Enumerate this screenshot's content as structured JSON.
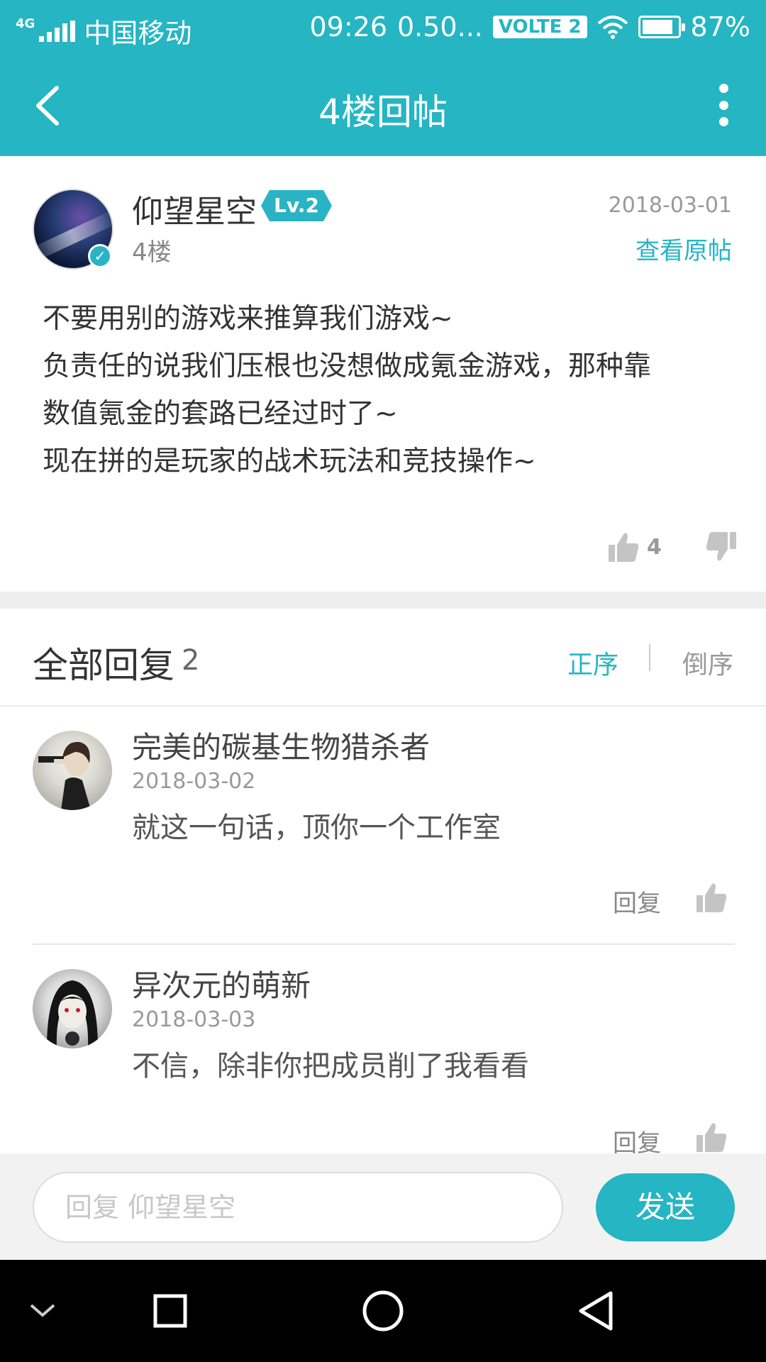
{
  "status_bar": {
    "network_type": "4G",
    "carrier": "中国移动",
    "time": "09:26",
    "speed": "0.50...",
    "volte": "VOLTE 2",
    "battery_percent": "87%",
    "battery_level": 0.87
  },
  "app_bar": {
    "title": "4楼回帖",
    "back_icon": "chevron-left-icon",
    "more_icon": "more-vertical-icon"
  },
  "post": {
    "author": "仰望星空",
    "level": "Lv.2",
    "floor": "4楼",
    "date": "2018-03-01",
    "view_original": "查看原帖",
    "content_lines": [
      "不要用别的游戏来推算我们游戏~",
      "负责任的说我们压根也没想做成氪金游戏，那种靠",
      "数值氪金的套路已经过时了~",
      "现在拼的是玩家的战术玩法和竞技操作~"
    ],
    "like_count": "4"
  },
  "replies": {
    "title": "全部回复",
    "count": "2",
    "sort_asc": "正序",
    "sort_desc": "倒序",
    "items": [
      {
        "name": "完美的碳基生物猎杀者",
        "date": "2018-03-02",
        "text": "就这一句话，顶你一个工作室",
        "reply_label": "回复"
      },
      {
        "name": "异次元的萌新",
        "date": "2018-03-03",
        "text": "不信，除非你把成员削了我看看",
        "reply_label": "回复"
      }
    ]
  },
  "input_bar": {
    "placeholder": "回复 仰望星空",
    "send_label": "发送"
  },
  "colors": {
    "accent": "#25b5c3",
    "nav_bg": "#000000"
  }
}
